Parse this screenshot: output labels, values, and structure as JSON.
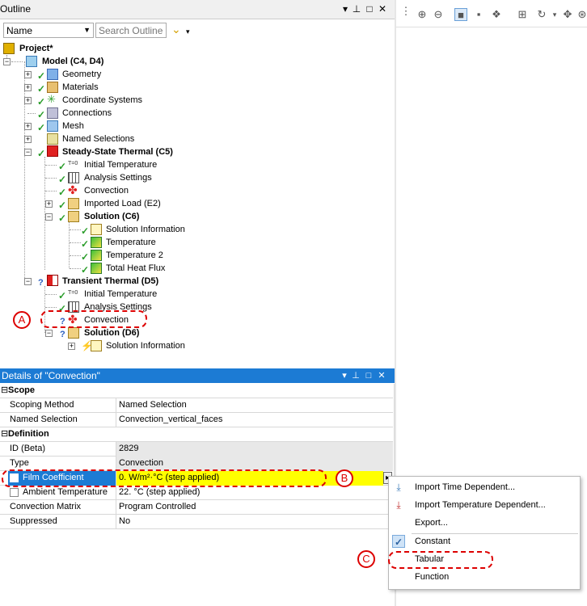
{
  "outline": {
    "title": "Outline",
    "name_select": "Name",
    "search_placeholder": "Search Outline",
    "tree": {
      "project": "Project*",
      "model": "Model (C4, D4)",
      "geometry": "Geometry",
      "materials": "Materials",
      "coord": "Coordinate Systems",
      "connections": "Connections",
      "mesh": "Mesh",
      "named_sel": "Named Selections",
      "sst": "Steady-State Thermal (C5)",
      "sst_init": "Initial Temperature",
      "sst_analysis": "Analysis Settings",
      "sst_conv": "Convection",
      "sst_import": "Imported Load (E2)",
      "sst_solution": "Solution (C6)",
      "sst_sol_info": "Solution Information",
      "sst_temp": "Temperature",
      "sst_temp2": "Temperature 2",
      "sst_heat": "Total Heat Flux",
      "tt": "Transient Thermal (D5)",
      "tt_init": "Initial Temperature",
      "tt_analysis": "Analysis Settings",
      "tt_conv": "Convection",
      "tt_solution": "Solution (D6)",
      "tt_sol_info": "Solution Information",
      "tt_init_icon": "T=0",
      "sst_init_icon": "T=0"
    }
  },
  "details": {
    "title": "Details of \"Convection\"",
    "scope_group": "Scope",
    "definition_group": "Definition",
    "rows": {
      "scoping_method": {
        "label": "Scoping Method",
        "value": "Named Selection"
      },
      "named_selection": {
        "label": "Named Selection",
        "value": "Convection_vertical_faces"
      },
      "id": {
        "label": "ID (Beta)",
        "value": "2829"
      },
      "type": {
        "label": "Type",
        "value": "Convection"
      },
      "film": {
        "label": "Film Coefficient",
        "value": "0. W/m²·°C  (step applied)"
      },
      "ambient": {
        "label": "Ambient Temperature",
        "value": "22. °C  (step applied)"
      },
      "matrix": {
        "label": "Convection Matrix",
        "value": "Program Controlled"
      },
      "suppressed": {
        "label": "Suppressed",
        "value": "No"
      }
    }
  },
  "context_menu": {
    "import_time": "Import Time Dependent...",
    "import_temp": "Import Temperature Dependent...",
    "export": "Export...",
    "constant": "Constant",
    "tabular": "Tabular",
    "function": "Function"
  },
  "annotations": {
    "a": "A",
    "b": "B",
    "c": "C"
  },
  "colors": {
    "highlight_blue": "#1c7bd4",
    "film_yellow": "#ffff00",
    "annotation_red": "#dd0000",
    "check_green": "#2a9d2a"
  }
}
